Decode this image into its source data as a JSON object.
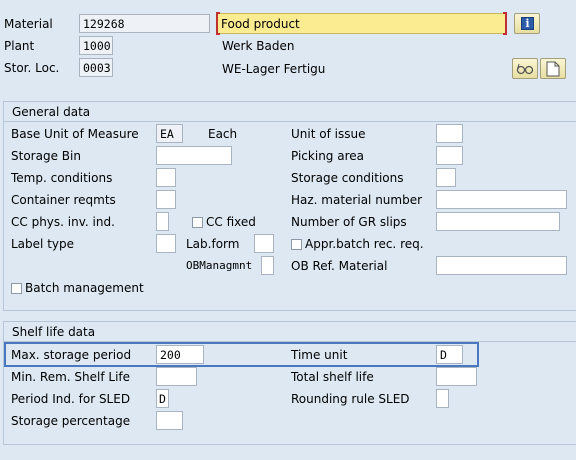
{
  "header": {
    "material_label": "Material",
    "material_value": "129268",
    "description": "Food product",
    "plant_label": "Plant",
    "plant_value": "1000",
    "plant_name": "Werk Baden",
    "storloc_label": "Stor. Loc.",
    "storloc_value": "0003",
    "storloc_name": "WE-Lager Fertigu"
  },
  "general": {
    "title": "General data",
    "base_uom_label": "Base Unit of Measure",
    "base_uom_value": "EA",
    "base_uom_text": "Each",
    "storage_bin_label": "Storage Bin",
    "temp_label": "Temp. conditions",
    "container_label": "Container reqmts",
    "cc_phys_label": "CC phys. inv. ind.",
    "cc_fixed_label": "CC fixed",
    "label_type_label": "Label type",
    "lab_form_label": "Lab.form",
    "ob_mgmt_label": "OBManagmnt",
    "batch_mgmt_label": "Batch management",
    "unit_issue_label": "Unit of issue",
    "picking_label": "Picking area",
    "storage_cond_label": "Storage conditions",
    "haz_label": "Haz. material number",
    "gr_slips_label": "Number of GR slips",
    "appr_batch_label": "Appr.batch rec. req.",
    "ob_ref_label": "OB Ref. Material"
  },
  "shelf": {
    "title": "Shelf life data",
    "max_storage_label": "Max. storage period",
    "max_storage_value": "200",
    "time_unit_label": "Time unit",
    "time_unit_value": "D",
    "min_rem_label": "Min. Rem. Shelf Life",
    "total_shelf_label": "Total shelf life",
    "period_ind_label": "Period Ind. for SLED",
    "period_ind_value": "D",
    "rounding_label": "Rounding rule SLED",
    "storage_pct_label": "Storage percentage"
  },
  "colors": {
    "background": "#dde8f2",
    "description_field": "#fbeb91",
    "highlight": "#4a78c0"
  },
  "icons": [
    "info-icon",
    "glasses-icon",
    "document-icon"
  ]
}
